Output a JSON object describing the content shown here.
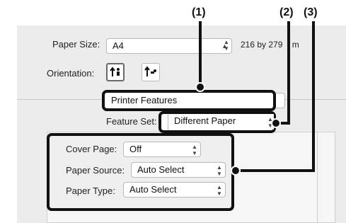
{
  "callouts": {
    "c1": "(1)",
    "c2": "(2)",
    "c3": "(3)"
  },
  "paper_size": {
    "label": "Paper Size:",
    "value": "A4",
    "dimension_prefix": "216 by 279",
    "dimension_suffix": "m"
  },
  "orientation": {
    "label": "Orientation:"
  },
  "panel_select": {
    "value": "Printer Features"
  },
  "feature_set": {
    "label": "Feature Set:",
    "value": "Different Paper"
  },
  "cover_page": {
    "label": "Cover Page:",
    "value": "Off"
  },
  "paper_source": {
    "label": "Paper Source:",
    "value": "Auto Select"
  },
  "paper_type": {
    "label": "Paper Type:",
    "value": "Auto Select"
  },
  "icons": {
    "portrait": "portrait-orientation-icon",
    "landscape": "landscape-orientation-icon",
    "popup_arrows": "updown-arrows-icon"
  }
}
